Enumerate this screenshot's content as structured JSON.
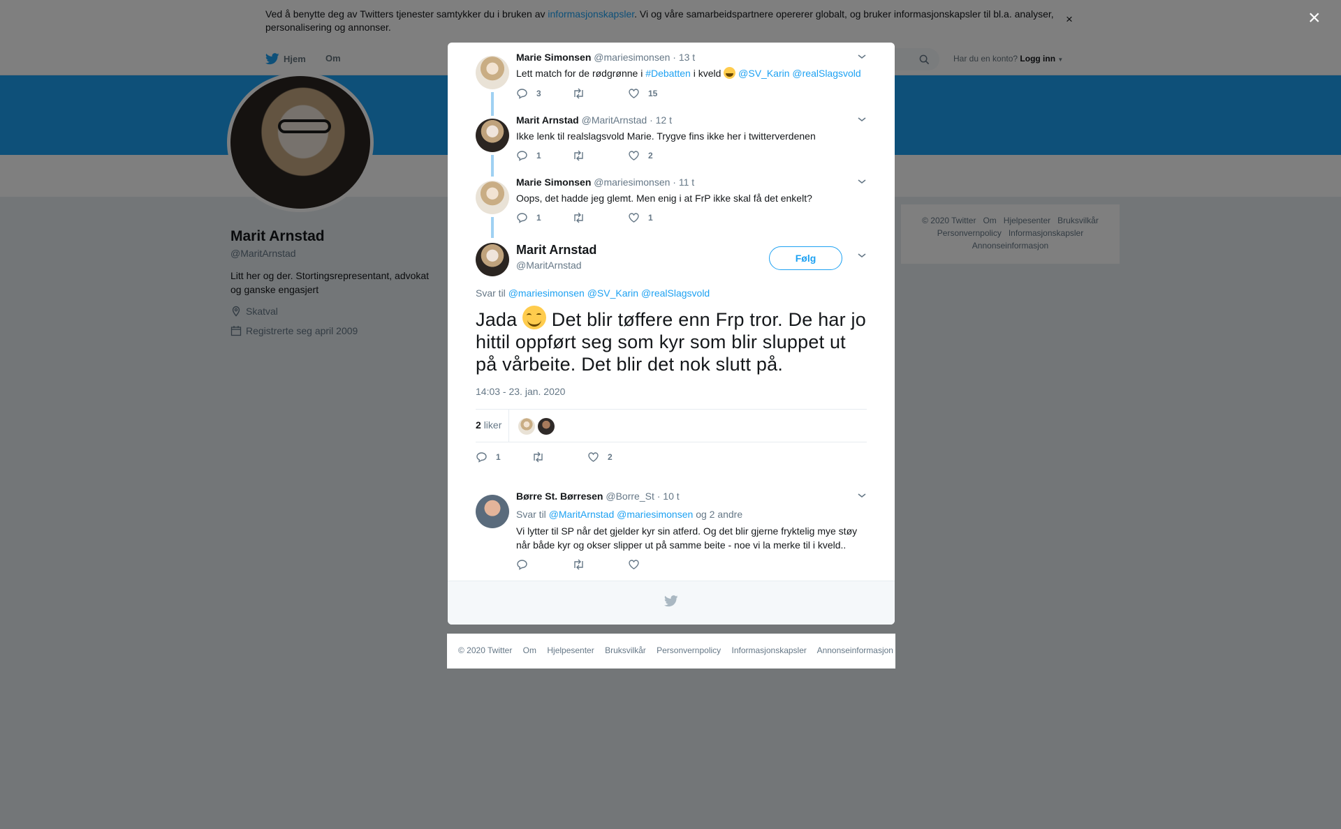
{
  "cookie_banner": {
    "text_before": "Ved å benytte deg av Twitters tjenester samtykker du i bruken av ",
    "link": "informasjonskapsler",
    "text_after": ". Vi og våre samarbeidspartnere opererer globalt, og bruker informasjonskapsler til bl.a. analyser, personalisering og annonser.",
    "close": "×"
  },
  "nav": {
    "home": "Hjem",
    "about": "Om",
    "account_question": "Har du en konto?",
    "login": "Logg inn"
  },
  "profile": {
    "name": "Marit Arnstad",
    "handle": "@MaritArnstad",
    "bio": "Litt her og der. Stortingsrepresentant, advokat og ganske engasjert",
    "location": "Skatval",
    "joined": "Registrerte seg april 2009"
  },
  "side_footer": [
    "© 2020 Twitter",
    "Om",
    "Hjelpesenter",
    "Bruksvilkår",
    "Personvernpolicy",
    "Informasjonskapsler",
    "Annonseinformasjon"
  ],
  "page_close": "×",
  "thread": [
    {
      "name": "Marie Simonsen",
      "handle": "@mariesimonsen",
      "time": "· 13 t",
      "text_parts": {
        "a": "Lett match for de rødgrønne i ",
        "hashtag": "#Debatten",
        "b": " i kveld ",
        "mentions": "@SV_Karin @realSlagsvold"
      },
      "replies": "3",
      "retweets": "",
      "likes": "15"
    },
    {
      "name": "Marit Arnstad",
      "handle": "@MaritArnstad",
      "time": "· 12 t",
      "text": "Ikke lenk til realslagsvold Marie. Trygve fins ikke her i twitterverdenen",
      "replies": "1",
      "retweets": "",
      "likes": "2"
    },
    {
      "name": "Marie Simonsen",
      "handle": "@mariesimonsen",
      "time": "· 11 t",
      "text": "Oops, det hadde jeg glemt. Men enig i at FrP ikke skal få det enkelt?",
      "replies": "1",
      "retweets": "",
      "likes": "1"
    }
  ],
  "main_tweet": {
    "name": "Marit Arnstad",
    "handle": "@MaritArnstad",
    "follow": "Følg",
    "reply_prefix": "Svar til",
    "reply_mentions": "@mariesimonsen @SV_Karin @realSlagsvold",
    "text_start": "Jada",
    "text_rest": " Det blir tøffere enn Frp tror. De har jo hittil oppført seg som kyr som blir sluppet ut på vårbeite. Det blir det nok slutt på.",
    "timestamp": "14:03 - 23. jan. 2020",
    "likes_count": "2",
    "likes_label": "liker",
    "replies": "1",
    "retweets": "",
    "likes": "2"
  },
  "reply_tweet": {
    "name": "Børre St. Børresen",
    "handle": "@Borre_St",
    "time": "· 10 t",
    "reply_prefix": "Svar til",
    "reply_mentions": "@MaritArnstad @mariesimonsen",
    "reply_suffix": "og 2 andre",
    "text": "Vi lytter til SP når det gjelder kyr sin atferd. Og det blir gjerne fryktelig mye støy når både kyr og okser slipper ut på samme beite - noe vi la merke til i kveld..",
    "replies": "",
    "retweets": "",
    "likes": ""
  },
  "page_footer": [
    "© 2020 Twitter",
    "Om",
    "Hjelpesenter",
    "Bruksvilkår",
    "Personvernpolicy",
    "Informasjonskapsler",
    "Annonseinformasjon"
  ],
  "colors": {
    "accent": "#1da1f2",
    "thread_line": "#9fd1f2",
    "muted": "#657786"
  }
}
